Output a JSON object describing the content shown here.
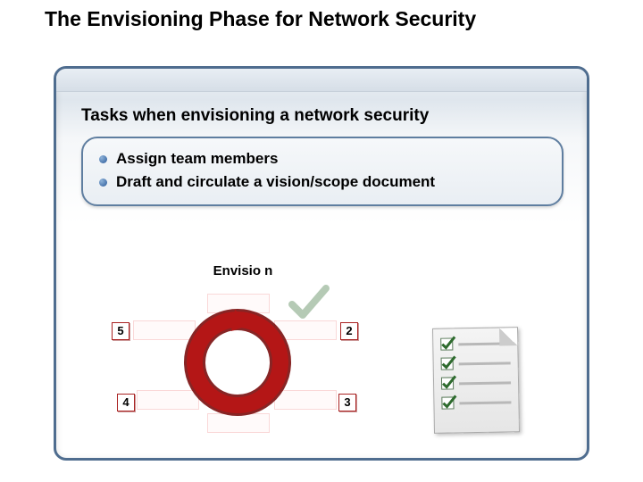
{
  "title": "The Envisioning Phase for Network Security",
  "subtitle": "Tasks when envisioning a network security",
  "tasks": {
    "item1": "Assign team members",
    "item2": "Draft and circulate a vision/scope document"
  },
  "diagram": {
    "envision_label": "Envisio\nn",
    "numbers": {
      "n2": "2",
      "n3": "3",
      "n4": "4",
      "n5": "5"
    }
  }
}
